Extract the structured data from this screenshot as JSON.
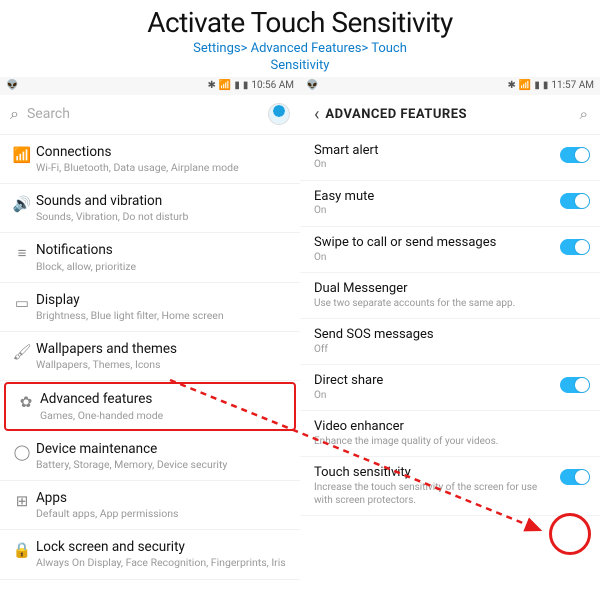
{
  "header": {
    "title": "Activate Touch Sensitivity",
    "breadcrumb_line1": "Settings> Advanced Features> Touch",
    "breadcrumb_line2": "Sensitivity"
  },
  "left": {
    "status": {
      "time": "10:56 AM"
    },
    "search": {
      "placeholder": "Search"
    },
    "items": [
      {
        "icon": "📶",
        "label": "Connections",
        "sub": "Wi-Fi, Bluetooth, Data usage, Airplane mode"
      },
      {
        "icon": "🔊",
        "label": "Sounds and vibration",
        "sub": "Sounds, Vibration, Do not disturb"
      },
      {
        "icon": "≡",
        "label": "Notifications",
        "sub": "Block, allow, prioritize"
      },
      {
        "icon": "▭",
        "label": "Display",
        "sub": "Brightness, Blue light filter, Home screen"
      },
      {
        "icon": "🖌",
        "label": "Wallpapers and themes",
        "sub": "Wallpapers, Themes, Icons"
      },
      {
        "icon": "✿",
        "label": "Advanced features",
        "sub": "Games, One-handed mode",
        "hi": true
      },
      {
        "icon": "◯",
        "label": "Device maintenance",
        "sub": "Battery, Storage, Memory, Device security"
      },
      {
        "icon": "⊞",
        "label": "Apps",
        "sub": "Default apps, App permissions"
      },
      {
        "icon": "🔒",
        "label": "Lock screen and security",
        "sub": "Always On Display, Face Recognition, Fingerprints, Iris"
      }
    ]
  },
  "right": {
    "status": {
      "time": "11:57 AM"
    },
    "title": "ADVANCED FEATURES",
    "items": [
      {
        "label": "Smart alert",
        "sub": "On",
        "tog": "on"
      },
      {
        "label": "Easy mute",
        "sub": "On",
        "tog": "on"
      },
      {
        "label": "Swipe to call or send messages",
        "sub": "On",
        "tog": "on"
      },
      {
        "label": "Dual Messenger",
        "sub": "Use two separate accounts for the same app.",
        "tog": ""
      },
      {
        "label": "Send SOS messages",
        "sub": "Off",
        "tog": ""
      },
      {
        "label": "Direct share",
        "sub": "On",
        "tog": "on"
      },
      {
        "label": "Video enhancer",
        "sub": "Enhance the image quality of your videos.",
        "tog": ""
      },
      {
        "label": "Touch sensitivity",
        "sub": "Increase the touch sensitivity of the screen for use with screen protectors.",
        "tog": "on"
      }
    ]
  }
}
